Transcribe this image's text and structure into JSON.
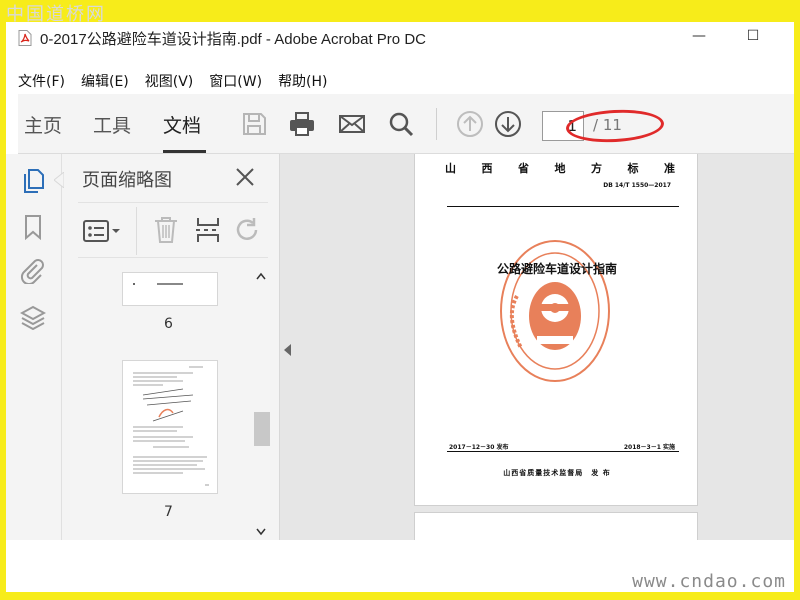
{
  "watermark_top": "中国道桥网",
  "watermark_bottom": "www.cndao.com",
  "window": {
    "title": "0-2017公路避险车道设计指南.pdf - Adobe Acrobat Pro DC",
    "minimize_glyph": "—",
    "maximize_glyph": "☐"
  },
  "menu": [
    "文件(F)",
    "编辑(E)",
    "视图(V)",
    "窗口(W)",
    "帮助(H)"
  ],
  "toolbar": {
    "tabs": [
      "主页",
      "工具",
      "文档"
    ],
    "active_tab": "文档",
    "icons": [
      "save-icon",
      "print-icon",
      "email-icon",
      "search-icon",
      "prev-page-icon",
      "next-page-icon"
    ],
    "current_page": "1",
    "total_pages": "/ 11",
    "highlight_color": "#e02a2a"
  },
  "rail": {
    "icons": [
      "page-thumbnails-icon",
      "bookmark-icon",
      "attachment-icon",
      "layers-icon"
    ],
    "accent": "#2d6fb8"
  },
  "thumbnails": {
    "title": "页面缩略图",
    "tools": [
      "options-icon",
      "delete-icon",
      "insert-icon",
      "undo-icon"
    ],
    "pages": [
      "6",
      "7"
    ]
  },
  "document": {
    "header": [
      "山",
      "西",
      "省",
      "地",
      "方",
      "标",
      "准"
    ],
    "code": "DB 14/T 1550—2017",
    "title": "公路避险车道设计指南",
    "seal_color": "#e8805a",
    "issue_date": "2017－12－30 发布",
    "effective_date": "2018－3－1 实施",
    "publisher": "山西省质量技术监督局　发 布"
  }
}
